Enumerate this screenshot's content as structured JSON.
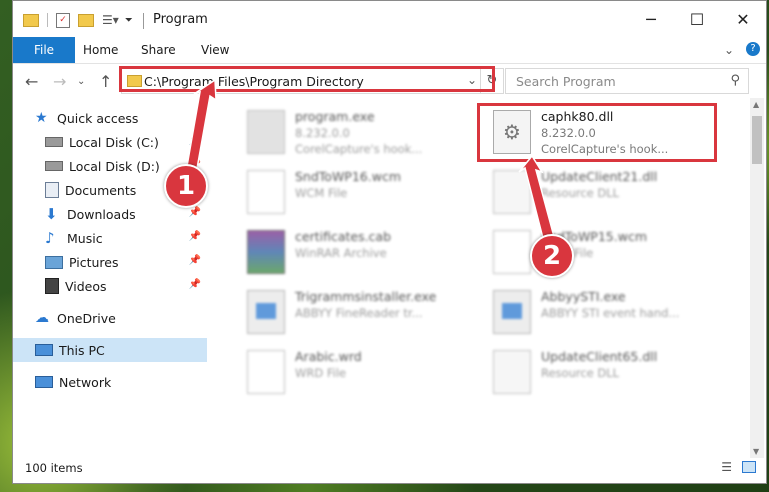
{
  "window": {
    "title": "Program"
  },
  "ribbon": {
    "tabs": [
      "File",
      "Home",
      "Share",
      "View"
    ]
  },
  "address": {
    "path": "C:\\Program Files\\Program Directory",
    "refresh_icon": "refresh-icon"
  },
  "search": {
    "placeholder": "Search Program"
  },
  "sidebar": {
    "items": [
      {
        "label": "Quick access",
        "icon": "star-icon"
      },
      {
        "label": "Local Disk (C:)",
        "icon": "drive-icon"
      },
      {
        "label": "Local Disk (D:)",
        "icon": "drive-icon"
      },
      {
        "label": "Documents",
        "icon": "documents-icon"
      },
      {
        "label": "Downloads",
        "icon": "download-icon"
      },
      {
        "label": "Music",
        "icon": "music-icon"
      },
      {
        "label": "Pictures",
        "icon": "pictures-icon"
      },
      {
        "label": "Videos",
        "icon": "videos-icon"
      },
      {
        "label": "OneDrive",
        "icon": "cloud-icon"
      },
      {
        "label": "This PC",
        "icon": "computer-icon"
      },
      {
        "label": "Network",
        "icon": "network-icon"
      }
    ]
  },
  "files": [
    {
      "name": "program.exe",
      "line1": "8.232.0.0",
      "line2": "CorelCapture's hook..."
    },
    {
      "name": "caphk80.dll",
      "line1": "8.232.0.0",
      "line2": "CorelCapture's hook..."
    },
    {
      "name": "SndToWP16.wcm",
      "line1": "WCM File",
      "line2": ""
    },
    {
      "name": "UpdateClient21.dll",
      "line1": "Resource DLL",
      "line2": ""
    },
    {
      "name": "certificates.cab",
      "line1": "WinRAR Archive",
      "line2": ""
    },
    {
      "name": "SndToWP15.wcm",
      "line1": "WCM File",
      "line2": ""
    },
    {
      "name": "Trigrammsinstaller.exe",
      "line1": "ABBYY FineReader tr...",
      "line2": ""
    },
    {
      "name": "AbbyySTI.exe",
      "line1": "ABBYY STI event hand...",
      "line2": ""
    },
    {
      "name": "Arabic.wrd",
      "line1": "WRD File",
      "line2": ""
    },
    {
      "name": "UpdateClient65.dll",
      "line1": "Resource DLL",
      "line2": ""
    }
  ],
  "status": {
    "count": "100 items"
  },
  "annotations": {
    "badge1": "1",
    "badge2": "2",
    "accent": "#d9363e"
  }
}
